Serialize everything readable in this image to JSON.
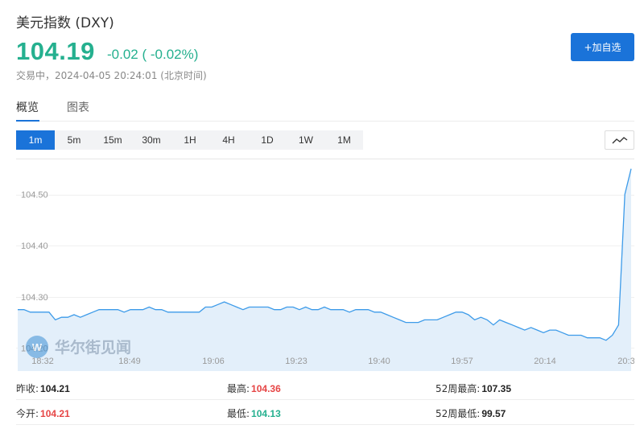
{
  "header": {
    "title": "美元指数 (DXY)",
    "price": "104.19",
    "change": "-0.02 ( -0.02%)",
    "status": "交易中，2024-04-05 20:24:01 (北京时间)",
    "add_watchlist": "+加自选"
  },
  "tabs": [
    {
      "label": "概览",
      "active": true
    },
    {
      "label": "图表",
      "active": false
    }
  ],
  "intervals": [
    {
      "label": "1m",
      "active": true
    },
    {
      "label": "5m"
    },
    {
      "label": "15m"
    },
    {
      "label": "30m"
    },
    {
      "label": "1H"
    },
    {
      "label": "4H"
    },
    {
      "label": "1D"
    },
    {
      "label": "1W"
    },
    {
      "label": "1M"
    }
  ],
  "chart_toggle_icon": "line-chart-icon",
  "chart_data": {
    "type": "area",
    "y_ticks": [
      "104.50",
      "104.40",
      "104.30",
      "104.20"
    ],
    "y_tick_values": [
      104.5,
      104.4,
      104.3,
      104.2
    ],
    "x_ticks": [
      "18:32",
      "18:49",
      "19:06",
      "19:23",
      "19:40",
      "19:57",
      "20:14",
      "20:3"
    ],
    "ylim": [
      104.155,
      104.57
    ],
    "grid": true,
    "line_color": "#3d9be9",
    "fill_color": "#e3effa",
    "watermark": "华尔街见闻",
    "values": [
      104.275,
      104.275,
      104.27,
      104.27,
      104.27,
      104.27,
      104.255,
      104.26,
      104.26,
      104.265,
      104.26,
      104.265,
      104.27,
      104.275,
      104.275,
      104.275,
      104.275,
      104.27,
      104.275,
      104.275,
      104.275,
      104.28,
      104.275,
      104.275,
      104.27,
      104.27,
      104.27,
      104.27,
      104.27,
      104.27,
      104.28,
      104.28,
      104.285,
      104.29,
      104.285,
      104.28,
      104.275,
      104.28,
      104.28,
      104.28,
      104.28,
      104.275,
      104.275,
      104.28,
      104.28,
      104.275,
      104.28,
      104.275,
      104.275,
      104.28,
      104.275,
      104.275,
      104.275,
      104.27,
      104.275,
      104.275,
      104.275,
      104.27,
      104.27,
      104.265,
      104.26,
      104.255,
      104.25,
      104.25,
      104.25,
      104.255,
      104.255,
      104.255,
      104.26,
      104.265,
      104.27,
      104.27,
      104.265,
      104.255,
      104.26,
      104.255,
      104.245,
      104.255,
      104.25,
      104.245,
      104.24,
      104.235,
      104.24,
      104.235,
      104.23,
      104.235,
      104.235,
      104.23,
      104.225,
      104.225,
      104.225,
      104.22,
      104.22,
      104.22,
      104.215,
      104.225,
      104.245,
      104.5,
      104.55
    ]
  },
  "stats": {
    "rows": [
      [
        {
          "label": "昨收:",
          "value": "104.21",
          "color": "#222222"
        },
        {
          "label": "最高:",
          "value": "104.36",
          "color": "#e64545"
        },
        {
          "label": "52周最高:",
          "value": "107.35",
          "color": "#222222"
        }
      ],
      [
        {
          "label": "今开:",
          "value": "104.21",
          "color": "#e64545"
        },
        {
          "label": "最低:",
          "value": "104.13",
          "color": "#25b08f"
        },
        {
          "label": "52周最低:",
          "value": "99.57",
          "color": "#222222"
        }
      ]
    ]
  }
}
